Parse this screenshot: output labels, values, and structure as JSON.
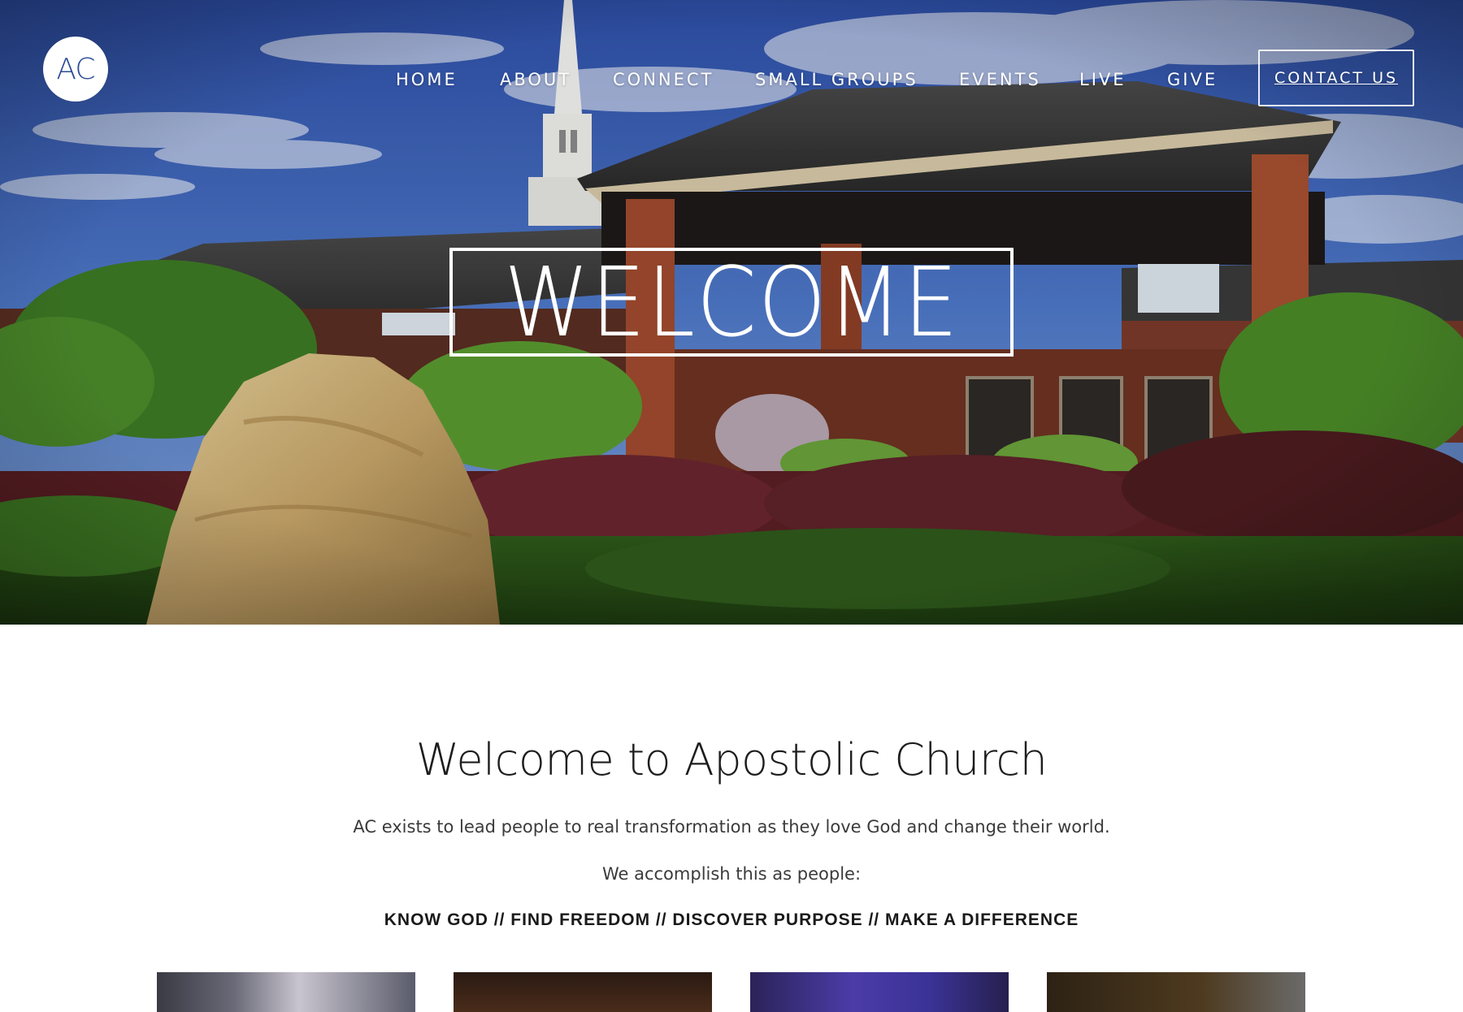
{
  "brand": {
    "logo_text": "AC",
    "accent_color": "#2a4c95"
  },
  "nav": {
    "items": [
      "HOME",
      "ABOUT",
      "CONNECT",
      "SMALL GROUPS",
      "EVENTS",
      "LIVE",
      "GIVE"
    ],
    "contact_label": "CONTACT US"
  },
  "hero": {
    "title": "WELCOME"
  },
  "intro": {
    "title": "Welcome to Apostolic Church",
    "mission": "AC exists to lead people to real transformation as they love God and change their world.",
    "lead_in": "We accomplish this as people:",
    "pillars": "KNOW GOD // FIND FREEDOM // DISCOVER PURPOSE // MAKE A DIFFERENCE"
  }
}
